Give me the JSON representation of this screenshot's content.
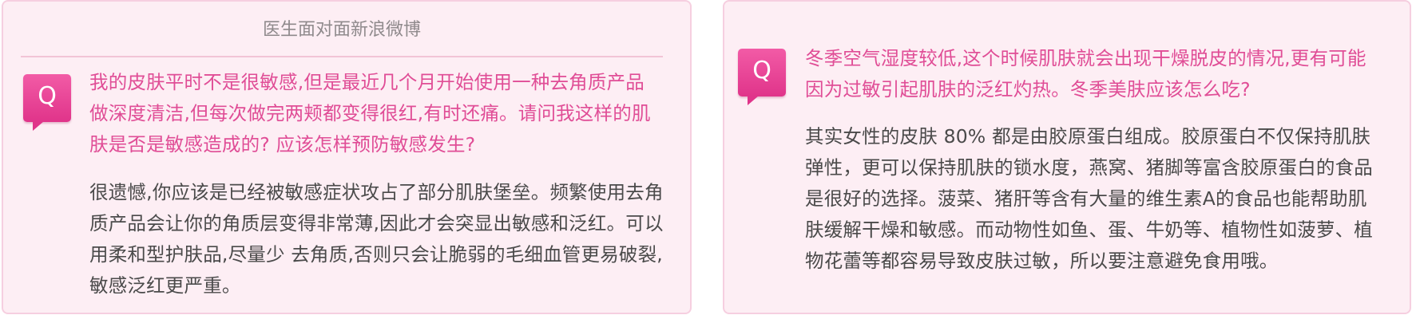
{
  "cards": [
    {
      "header": "医生面对面新浪微博",
      "badge": "Q",
      "question_lines": [
        "我的皮肤平时不是很敏感,但是最近几个月开始使用一种去角质产品",
        "做深度清洁,但每次做完两颊都变得很红,有时还痛。请问我这样的肌",
        "肤是否是敏感造成的? 应该怎样预防敏感发生?"
      ],
      "answer_lines": [
        "很遗憾,你应该是已经被敏感症状攻占了部分肌肤堡垒。频繁使用去角",
        "质产品会让你的角质层变得非常薄,因此才会突显出敏感和泛红。可以",
        "用柔和型护肤品,尽量少 去角质,否则只会让脆弱的毛细血管更易破裂,",
        "敏感泛红更严重。"
      ]
    },
    {
      "badge": "Q",
      "question_lines": [
        "冬季空气湿度较低,这个时候肌肤就会出现干燥脱皮的情况,更有可能",
        "因为过敏引起肌肤的泛红灼热。冬季美肤应该怎么吃?"
      ],
      "answer_lines": [
        "其实女性的皮肤 80% 都是由胶原蛋白组成。胶原蛋白不仅保持肌肤",
        "弹性，更可以保持肌肤的锁水度，燕窝、猪脚等富含胶原蛋白的食品",
        "是很好的选择。菠菜、猪肝等含有大量的维生素A的食品也能帮助肌",
        "肤缓解干燥和敏感。而动物性如鱼、蛋、牛奶等、植物性如菠萝、植",
        "物花蕾等都容易导致皮肤过敏，所以要注意避免食用哦。"
      ]
    }
  ],
  "colors": {
    "card_background": "#fdeef4",
    "card_border": "#f6cfe0",
    "question_text": "#e04d96",
    "answer_text": "#4a4a4a",
    "header_text": "#8f8a8c",
    "badge": "#e83d91"
  }
}
